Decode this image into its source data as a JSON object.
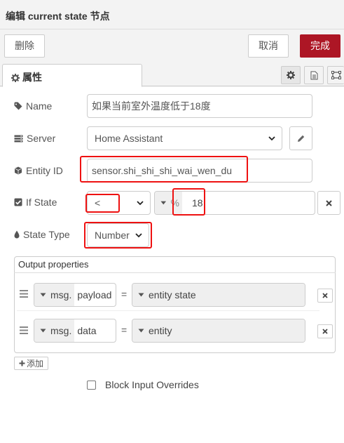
{
  "dialog": {
    "title": "编辑 current state 节点"
  },
  "toolbar": {
    "delete_label": "删除",
    "cancel_label": "取消",
    "done_label": "完成"
  },
  "tabs": {
    "properties_label": "属性"
  },
  "form": {
    "name": {
      "label": "Name",
      "value": "如果当前室外温度低于18度"
    },
    "server": {
      "label": "Server",
      "value": "Home Assistant"
    },
    "entity_id": {
      "label": "Entity ID",
      "value": "sensor.shi_shi_shi_wai_wen_du"
    },
    "if_state": {
      "label": "If State",
      "operator": "<",
      "type_symbol": "%",
      "value": "18"
    },
    "state_type": {
      "label": "State Type",
      "value": "Number"
    }
  },
  "output": {
    "title": "Output properties",
    "rows": [
      {
        "prefix": "msg.",
        "property": "payload",
        "eq": "=",
        "value": "entity state"
      },
      {
        "prefix": "msg.",
        "property": "data",
        "eq": "=",
        "value": "entity"
      }
    ],
    "add_label": "添加"
  },
  "block_input": {
    "label": "Block Input Overrides",
    "checked": false
  },
  "colors": {
    "accent": "#ad1625",
    "highlight": "#ee1111",
    "tabs_border": "#cccccc"
  }
}
